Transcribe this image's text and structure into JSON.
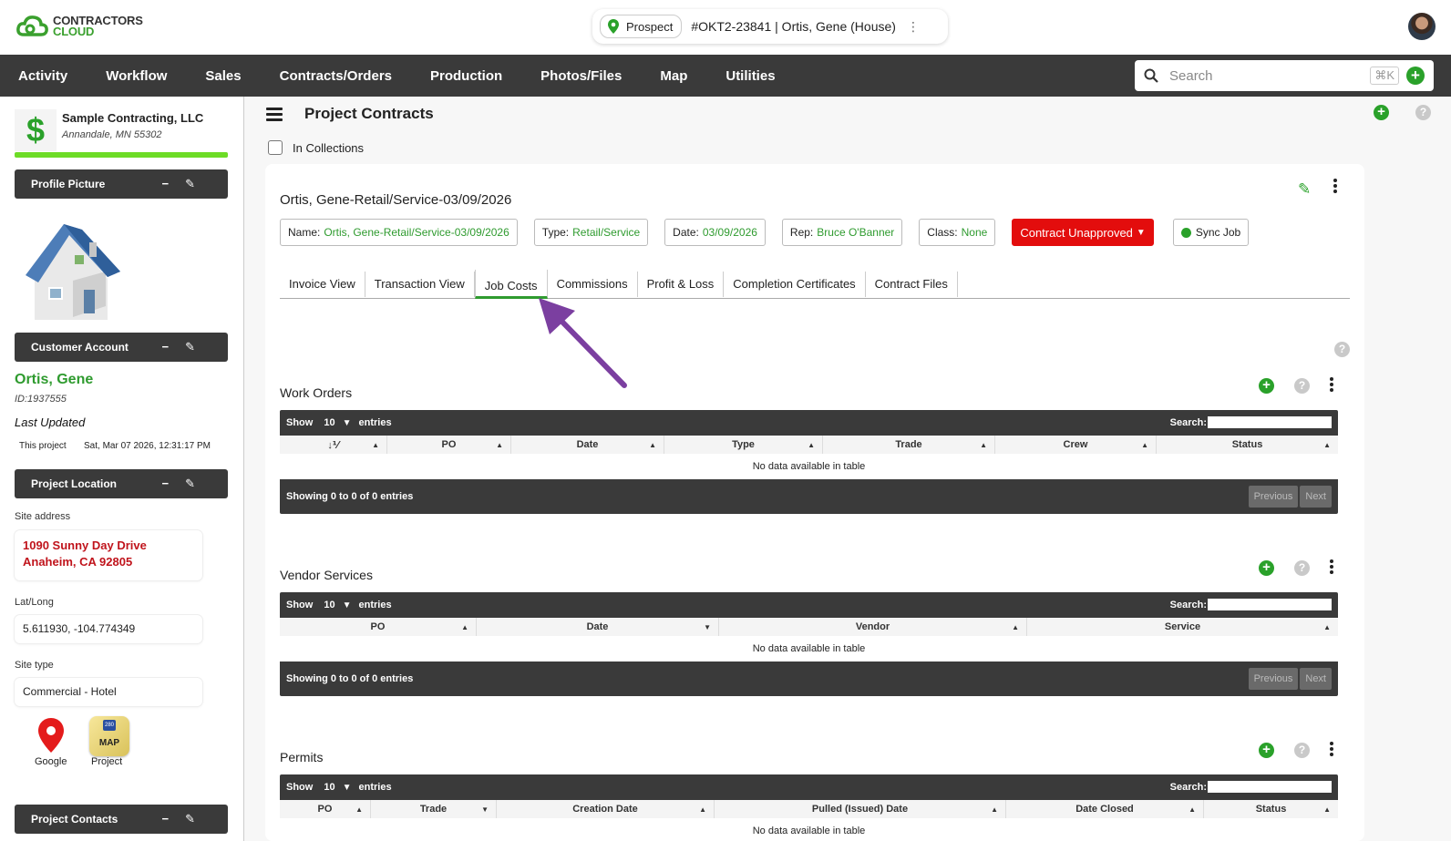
{
  "header": {
    "logo_line1": "CONTRACTORS",
    "logo_line2": "CLOUD",
    "status_pill": "Prospect",
    "job_title": "#OKT2-23841 | Ortis, Gene (House)"
  },
  "nav": {
    "items": [
      "Activity",
      "Workflow",
      "Sales",
      "Contracts/Orders",
      "Production",
      "Photos/Files",
      "Map",
      "Utilities"
    ],
    "search_placeholder": "Search",
    "shortcut": "⌘K"
  },
  "sidebar": {
    "company_name": "Sample Contracting, LLC",
    "company_location": "Annandale, MN 55302",
    "panels": {
      "profile_picture": "Profile Picture",
      "customer_account": "Customer Account",
      "project_location": "Project Location",
      "project_contacts": "Project Contacts"
    },
    "customer_name": "Ortis, Gene",
    "customer_id": "ID:1937555",
    "last_updated_label": "Last Updated",
    "this_project_label": "This project",
    "this_project_date": "Sat, Mar 07 2026, 12:31:17 PM",
    "site_address_label": "Site address",
    "site_address_line1": "1090 Sunny Day Drive",
    "site_address_line2": "Anaheim, CA 92805",
    "latlong_label": "Lat/Long",
    "latlong_value": "5.611930, -104.774349",
    "site_type_label": "Site type",
    "site_type_value": "Commercial - Hotel",
    "map_google_label": "Google",
    "map_project_label": "Project",
    "map_icon_text": "MAP",
    "map_icon_badge": "280"
  },
  "main": {
    "page_title": "Project Contracts",
    "in_collections_label": "In Collections",
    "contract_title": "Ortis, Gene-Retail/Service-03/09/2026",
    "tags": {
      "name_label": "Name:",
      "name_value": "Ortis, Gene-Retail/Service-03/09/2026",
      "type_label": "Type:",
      "type_value": "Retail/Service",
      "date_label": "Date:",
      "date_value": "03/09/2026",
      "rep_label": "Rep:",
      "rep_value": "Bruce O'Banner",
      "class_label": "Class:",
      "class_value": "None",
      "status": "Contract Unapproved",
      "sync": "Sync Job"
    },
    "tabs": [
      "Invoice View",
      "Transaction View",
      "Job Costs",
      "Commissions",
      "Profit & Loss",
      "Completion Certificates",
      "Contract Files"
    ],
    "active_tab": "Job Costs"
  },
  "tables": {
    "show_label": "Show",
    "show_value": "10",
    "entries_label": "entries",
    "search_label": "Search:",
    "empty_text": "No data available in table",
    "footer_text": "Showing 0 to 0 of 0 entries",
    "prev_label": "Previous",
    "next_label": "Next",
    "work_orders": {
      "title": "Work Orders",
      "columns": [
        "↓⅟",
        "PO",
        "Date",
        "Type",
        "Trade",
        "Crew",
        "Status"
      ]
    },
    "vendor_services": {
      "title": "Vendor Services",
      "columns": [
        "PO",
        "Date",
        "Vendor",
        "Service"
      ]
    },
    "permits": {
      "title": "Permits",
      "columns": [
        "PO",
        "Trade",
        "Creation Date",
        "Pulled (Issued) Date",
        "Date Closed",
        "Status"
      ]
    }
  },
  "colors": {
    "brand_green": "#2f9b2f",
    "nav_dark": "#3a3a3a",
    "alert_red": "#e30d0d",
    "address_red": "#c0141c",
    "arrow_purple": "#7b3fa0"
  }
}
